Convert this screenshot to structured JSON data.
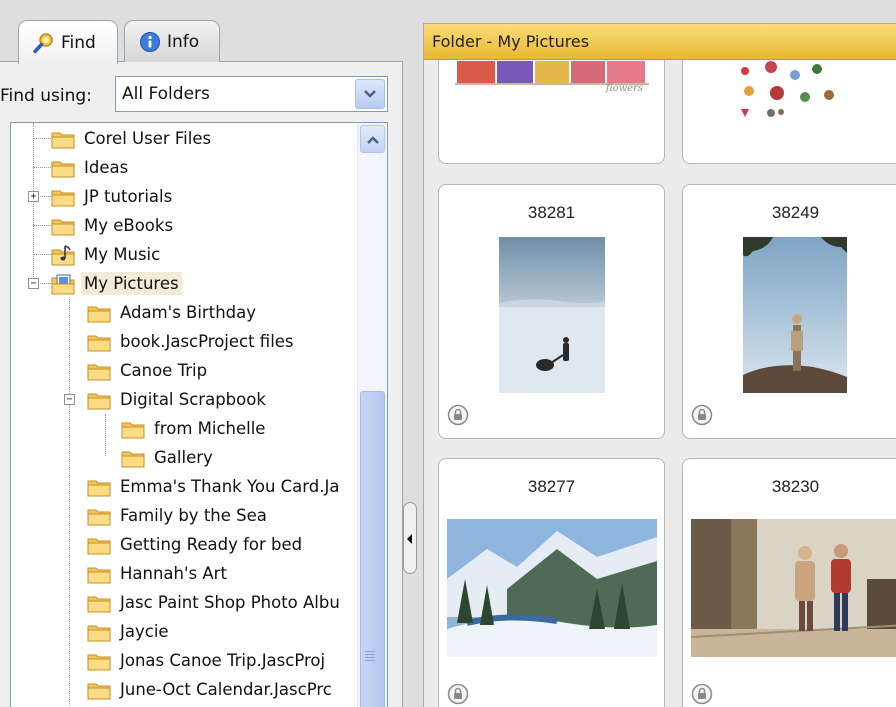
{
  "tabs": {
    "find": "Find",
    "info": "Info"
  },
  "find_using": {
    "label": "Find using:",
    "selected": "All Folders"
  },
  "tree": {
    "items": [
      {
        "label": "Corel User Files",
        "icon": "folder-icon"
      },
      {
        "label": "Ideas",
        "icon": "folder-icon"
      },
      {
        "label": "JP tutorials",
        "icon": "folder-icon",
        "expander": "+"
      },
      {
        "label": "My eBooks",
        "icon": "folder-icon"
      },
      {
        "label": "My Music",
        "icon": "music-folder-icon"
      },
      {
        "label": "My Pictures",
        "icon": "pictures-folder-icon",
        "expander": "-",
        "selected": true
      },
      {
        "label": "Adam's Birthday",
        "icon": "folder-icon"
      },
      {
        "label": "book.JascProject files",
        "icon": "folder-icon"
      },
      {
        "label": "Canoe Trip",
        "icon": "folder-icon"
      },
      {
        "label": "Digital Scrapbook",
        "icon": "folder-icon",
        "expander": "-"
      },
      {
        "label": "from Michelle",
        "icon": "folder-icon"
      },
      {
        "label": "Gallery",
        "icon": "folder-icon"
      },
      {
        "label": "Emma's Thank You Card.Ja",
        "icon": "folder-icon"
      },
      {
        "label": "Family by the Sea",
        "icon": "folder-icon"
      },
      {
        "label": "Getting Ready for bed",
        "icon": "folder-icon"
      },
      {
        "label": "Hannah's Art",
        "icon": "folder-icon"
      },
      {
        "label": "Jasc Paint Shop Photo Albu",
        "icon": "folder-icon"
      },
      {
        "label": "Jaycie",
        "icon": "folder-icon"
      },
      {
        "label": "Jonas Canoe Trip.JascProj",
        "icon": "folder-icon"
      },
      {
        "label": "June-Oct Calendar.JascPrc",
        "icon": "folder-icon"
      }
    ]
  },
  "folder_header": "Folder - My Pictures",
  "thumbnails": [
    {
      "label": "38281",
      "icon": "lock-icon"
    },
    {
      "label": "38249",
      "icon": "lock-icon"
    },
    {
      "label": "38277",
      "icon": "lock-icon"
    },
    {
      "label": "38230",
      "icon": "lock-icon"
    }
  ],
  "partial_thumb_text": "flowers",
  "colors": {
    "header_bg": "#f0c94f",
    "selected_row": "#f3ead8",
    "folder": "#f4c65a",
    "scroll_blue": "#b9cdf3"
  }
}
